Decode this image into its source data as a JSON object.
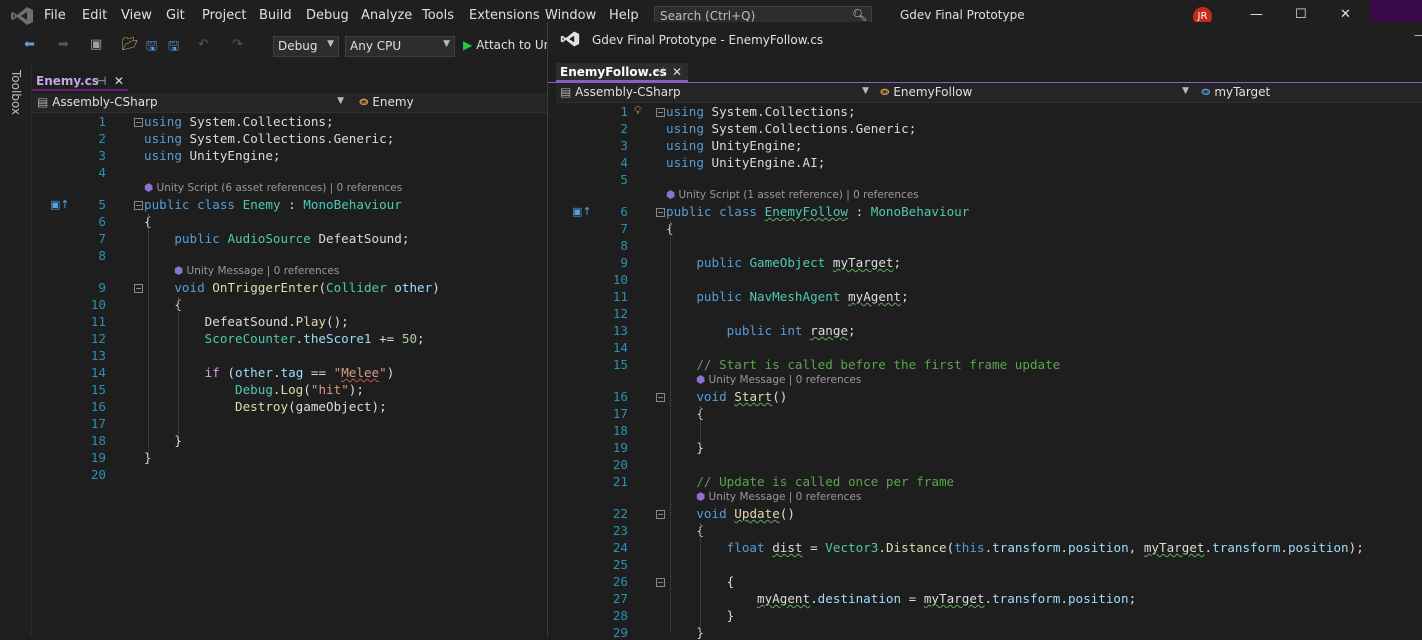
{
  "menubar": {
    "items": [
      "File",
      "Edit",
      "View",
      "Git",
      "Project",
      "Build",
      "Debug",
      "Analyze",
      "Tools",
      "Extensions",
      "Window",
      "Help"
    ],
    "search_placeholder": "Search (Ctrl+Q)",
    "solution_title": "Gdev Final Prototype",
    "avatar_initials": "JR",
    "minimize": "—",
    "maximize": "☐",
    "close": "✕"
  },
  "toolbar": {
    "config": "Debug",
    "platform": "Any CPU",
    "attach_label": "Attach to Un"
  },
  "toolbox_label": "Toolbox",
  "left_editor": {
    "tab_label": "Enemy.cs",
    "tab_pin": "⊣",
    "tab_close": "✕",
    "nav_project": "Assembly-CSharp",
    "nav_class": "Enemy",
    "lens_script": "Unity Script (6 asset references) | 0 references",
    "lens_message": "Unity Message | 0 references",
    "lines": [
      "1",
      "2",
      "3",
      "4",
      "5",
      "6",
      "7",
      "8",
      "9",
      "10",
      "11",
      "12",
      "13",
      "14",
      "15",
      "16",
      "17",
      "18",
      "19",
      "20"
    ],
    "code": [
      {
        "t": "using System.Collections;"
      },
      {
        "t": "using System.Collections.Generic;"
      },
      {
        "t": "using UnityEngine;"
      },
      {
        "t": ""
      },
      {
        "t": "public class Enemy : MonoBehaviour"
      },
      {
        "t": "{"
      },
      {
        "t": "    public AudioSource DefeatSound;"
      },
      {
        "t": ""
      },
      {
        "t": "    void OnTriggerEnter(Collider other)"
      },
      {
        "t": "    {"
      },
      {
        "t": "        DefeatSound.Play();"
      },
      {
        "t": "        ScoreCounter.theScore1 += 50;"
      },
      {
        "t": ""
      },
      {
        "t": "        if (other.tag == \"Melee\")"
      },
      {
        "t": "            Debug.Log(\"hit\");"
      },
      {
        "t": "            Destroy(gameObject);"
      },
      {
        "t": ""
      },
      {
        "t": "    }"
      },
      {
        "t": "}"
      },
      {
        "t": ""
      }
    ]
  },
  "right_window": {
    "title": "Gdev Final Prototype - EnemyFollow.cs",
    "tab_label": "EnemyFollow.cs",
    "tab_pin": "⊣",
    "tab_close": "✕",
    "nav_project": "Assembly-CSharp",
    "nav_class": "EnemyFollow",
    "nav_member": "myTarget",
    "lens_script": "Unity Script (1 asset reference) | 0 references",
    "lens_message": "Unity Message | 0 references",
    "lines": [
      "1",
      "2",
      "3",
      "4",
      "5",
      "6",
      "7",
      "8",
      "9",
      "10",
      "11",
      "12",
      "13",
      "14",
      "15",
      "16",
      "17",
      "18",
      "19",
      "20",
      "21",
      "22",
      "23",
      "24",
      "25",
      "26",
      "27",
      "28",
      "29"
    ],
    "code": [
      {
        "t": "using System.Collections;"
      },
      {
        "t": "using System.Collections.Generic;"
      },
      {
        "t": "using UnityEngine;"
      },
      {
        "t": "using UnityEngine.AI;"
      },
      {
        "t": ""
      },
      {
        "t": "public class EnemyFollow : MonoBehaviour"
      },
      {
        "t": "{"
      },
      {
        "t": ""
      },
      {
        "t": "    public GameObject myTarget;"
      },
      {
        "t": ""
      },
      {
        "t": "    public NavMeshAgent myAgent;"
      },
      {
        "t": ""
      },
      {
        "t": "        public int range;"
      },
      {
        "t": ""
      },
      {
        "t": "    // Start is called before the first frame update"
      },
      {
        "t": "    void Start()"
      },
      {
        "t": "    {"
      },
      {
        "t": ""
      },
      {
        "t": "    }"
      },
      {
        "t": ""
      },
      {
        "t": "    // Update is called once per frame"
      },
      {
        "t": "    void Update()"
      },
      {
        "t": "    {"
      },
      {
        "t": "        float dist = Vector3.Distance(this.transform.position, myTarget.transform.position);"
      },
      {
        "t": ""
      },
      {
        "t": "        {"
      },
      {
        "t": "            myAgent.destination = myTarget.transform.position;"
      },
      {
        "t": "        }"
      },
      {
        "t": "    }"
      }
    ]
  },
  "colors": {
    "accent": "#68217a",
    "keyword": "#569cd6",
    "type": "#4ec9b0",
    "string": "#d69d85",
    "comment": "#57a64a",
    "number": "#b5cea8",
    "method": "#dcdcaa",
    "linenumber": "#2b91af"
  }
}
